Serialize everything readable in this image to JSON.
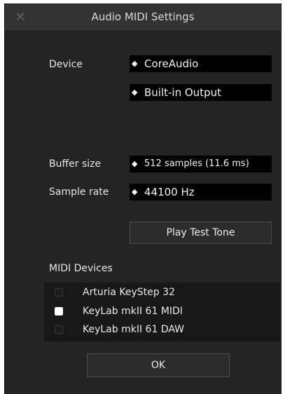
{
  "window": {
    "title": "Audio MIDI Settings",
    "close_glyph": "✕"
  },
  "device": {
    "label": "Device",
    "driver": "CoreAudio",
    "output": "Built-in Output"
  },
  "buffer": {
    "label": "Buffer size",
    "value": "512 samples (11.6 ms)"
  },
  "sample_rate": {
    "label": "Sample rate",
    "value": "44100 Hz"
  },
  "select_arrow": "◆",
  "test_tone_label": "Play Test Tone",
  "midi": {
    "heading": "MIDI Devices",
    "items": [
      {
        "name": "Arturia KeyStep 32",
        "checked": false
      },
      {
        "name": "KeyLab mkII 61 MIDI",
        "checked": true
      },
      {
        "name": "KeyLab mkII 61 DAW",
        "checked": false
      }
    ]
  },
  "ok_label": "OK",
  "colors": {
    "window_bg": "#242424",
    "titlebar_bg": "#333333",
    "select_bg": "#000000",
    "list_bg": "#181818"
  }
}
